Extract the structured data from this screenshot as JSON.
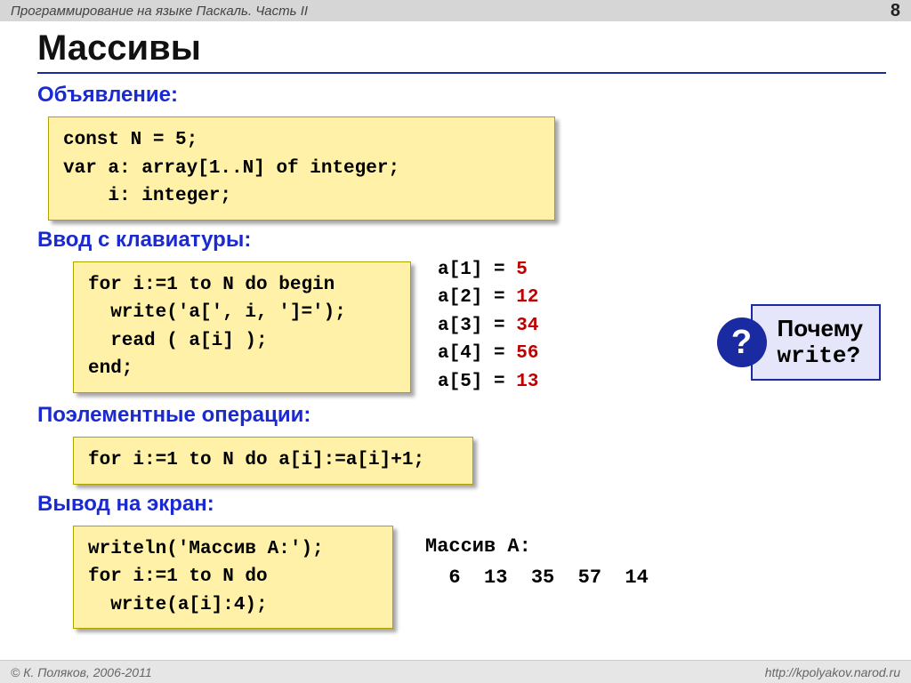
{
  "header": {
    "course_title": "Программирование на языке Паскаль. Часть II",
    "page_number": "8"
  },
  "title": "Массивы",
  "sections": {
    "declaration": {
      "heading": "Объявление:",
      "code": "const N = 5;\nvar a: array[1..N] of integer;\n    i: integer;"
    },
    "input": {
      "heading": "Ввод с клавиатуры:",
      "code": "for i:=1 to N do begin\n  write('a[', i, ']=');\n  read ( a[i] );\nend;",
      "sample_values": [
        {
          "label": "a[1] =",
          "value": "5"
        },
        {
          "label": "a[2] =",
          "value": "12"
        },
        {
          "label": "a[3] =",
          "value": "34"
        },
        {
          "label": "a[4] =",
          "value": "56"
        },
        {
          "label": "a[5] =",
          "value": "13"
        }
      ]
    },
    "ops": {
      "heading": "Поэлементные операции:",
      "code": "for i:=1 to N do a[i]:=a[i]+1;"
    },
    "output": {
      "heading": "Вывод на экран:",
      "code": "writeln('Массив A:');\nfor i:=1 to N do\n  write(a[i]:4);",
      "result_title": "Массив A:",
      "result_values": "  6  13  35  57  14"
    }
  },
  "callout": {
    "icon": "?",
    "line1": "Почему",
    "line2": "write?"
  },
  "footer": {
    "copyright": "© К. Поляков, 2006-2011",
    "url": "http://kpolyakov.narod.ru"
  }
}
